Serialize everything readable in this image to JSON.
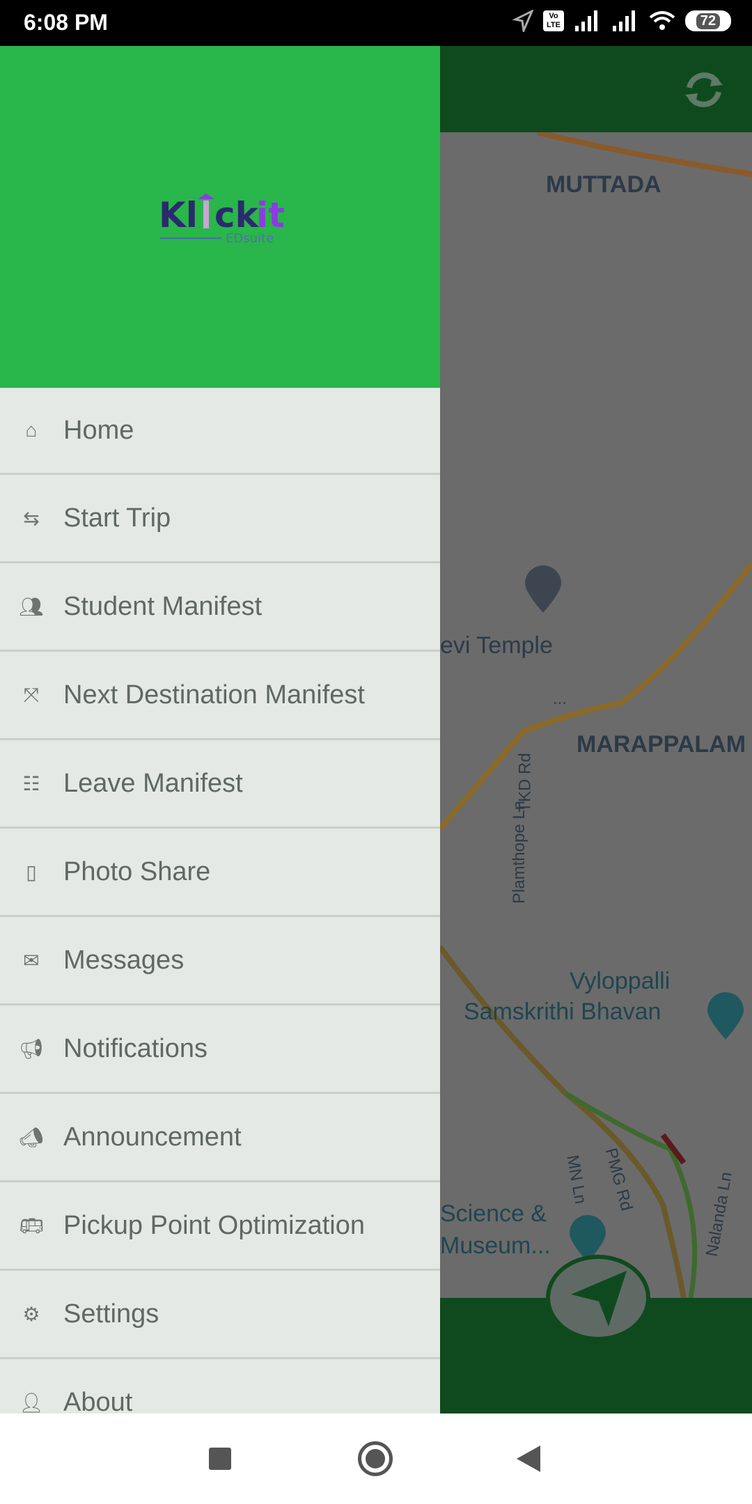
{
  "status_bar": {
    "time": "6:08 PM",
    "battery": "72",
    "network_badge": "Vo LTE"
  },
  "app": {
    "logo_text": "Klickit",
    "logo_subtext": "EDsuite",
    "primary_color": "#29b64a",
    "toolbar_color": "#0f4a1e"
  },
  "menu": {
    "items": [
      {
        "label": "Home",
        "icon": "home-icon"
      },
      {
        "label": "Start Trip",
        "icon": "swap-icon"
      },
      {
        "label": "Student Manifest",
        "icon": "users-icon"
      },
      {
        "label": "Next Destination Manifest",
        "icon": "expand-icon"
      },
      {
        "label": "Leave Manifest",
        "icon": "list-check-icon"
      },
      {
        "label": "Photo Share",
        "icon": "phone-badge-icon"
      },
      {
        "label": "Messages",
        "icon": "envelope-icon"
      },
      {
        "label": "Notifications",
        "icon": "megaphone-icon"
      },
      {
        "label": "Announcement",
        "icon": "bullhorn-icon"
      },
      {
        "label": "Pickup Point Optimization",
        "icon": "bus-icon"
      },
      {
        "label": "Settings",
        "icon": "gears-icon"
      },
      {
        "label": "About",
        "icon": "user-icon"
      }
    ]
  },
  "map": {
    "labels": [
      "MUTTADA",
      "evi Temple",
      "MARAPPALAM",
      "Vyloppalli",
      "Samskrithi Bhavan",
      "Science &",
      "Museum...",
      "TKD Rd",
      "Plamthope Ln",
      "PMG Rd",
      "MN Ln",
      "Nalanda Ln",
      "..."
    ]
  }
}
